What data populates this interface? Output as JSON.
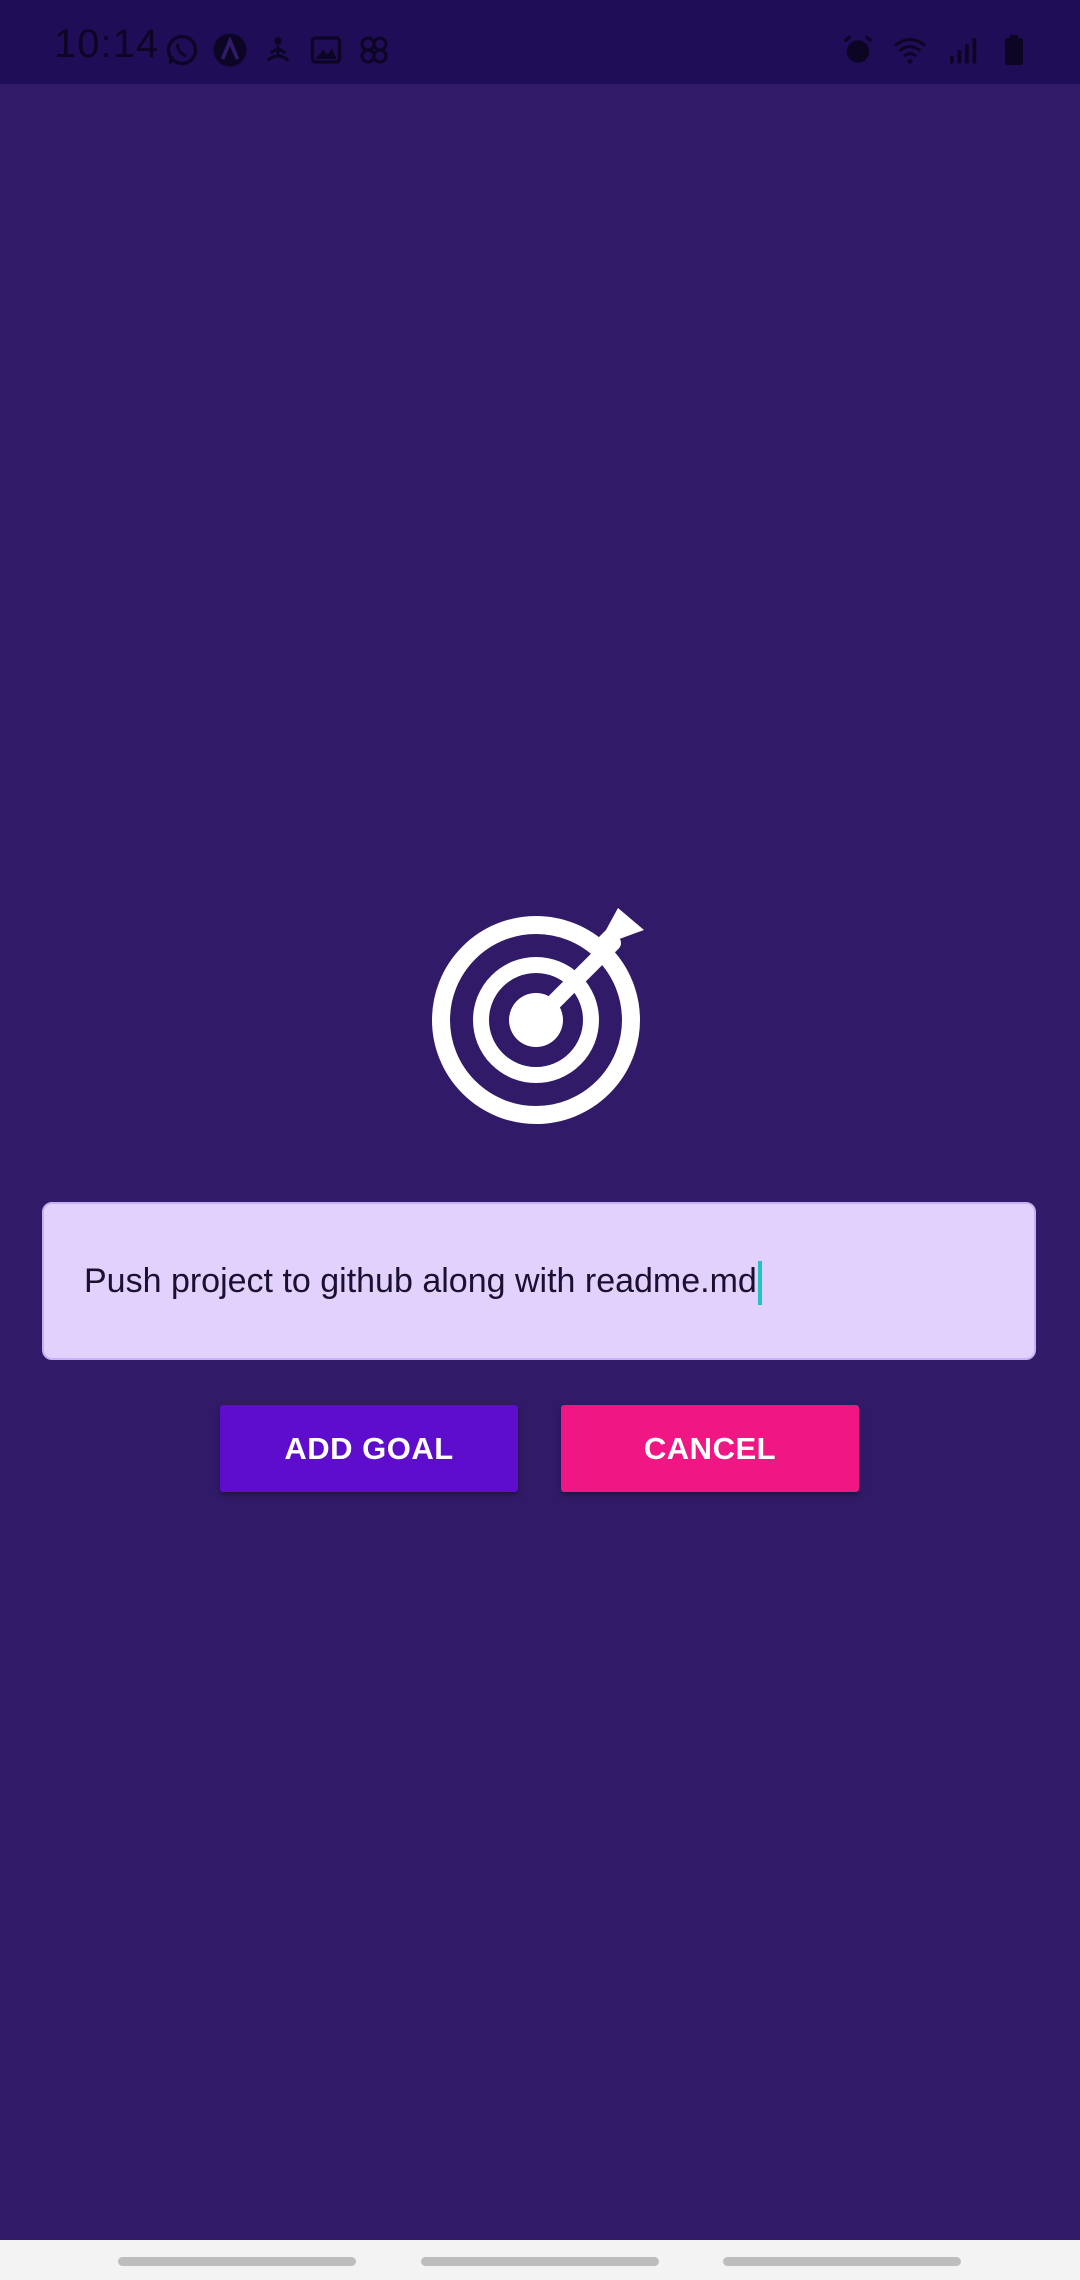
{
  "status_bar": {
    "time": "10:14",
    "left_icons": [
      "whatsapp-icon",
      "app-a-icon",
      "meditation-icon",
      "gallery-icon",
      "pinwheel-icon"
    ],
    "right_icons": [
      "alarm-icon",
      "wifi-icon",
      "signal-icon",
      "battery-icon"
    ]
  },
  "main": {
    "icon": "target-arrow-icon",
    "goal_input": {
      "value": "Push project to github along with readme.md",
      "placeholder": ""
    },
    "buttons": {
      "add_label": "ADD GOAL",
      "cancel_label": "CANCEL"
    }
  },
  "colors": {
    "background": "#311b68",
    "status_bar": "#1f0d57",
    "input_bg": "#e2d0fd",
    "add_button": "#5d0dcb",
    "cancel_button": "#f01683",
    "caret": "#22c3c3"
  }
}
